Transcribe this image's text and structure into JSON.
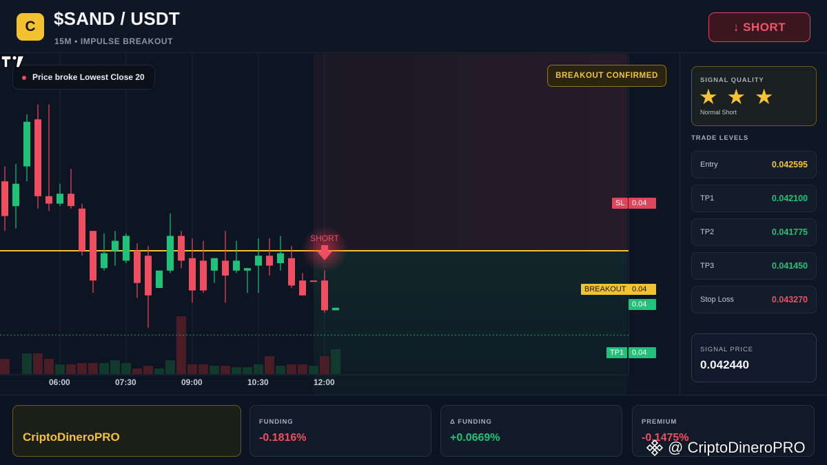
{
  "header": {
    "logo_letter": "C",
    "pair": "$SAND / USDT",
    "subtitle": "15M • IMPULSE BREAKOUT",
    "short_button": "↓ SHORT"
  },
  "chart": {
    "signal_pill": "Price broke Lowest Close 20",
    "confirmed_badge": "BREAKOUT CONFIRMED",
    "short_marker": "SHORT",
    "lines": {
      "sl": {
        "label": "SL",
        "value": "0.04"
      },
      "breakout": {
        "label": "BREAKOUT",
        "value": "0.04"
      },
      "current": {
        "value": "0.04"
      },
      "tp1": {
        "label": "TP1",
        "value": "0.04"
      }
    },
    "x_labels": [
      "06:00",
      "07:30",
      "09:00",
      "10:30",
      "12:00"
    ],
    "colors": {
      "up": "#21c17a",
      "down": "#ef4d60",
      "breakout": "#f3c230",
      "sl": "#e0455c",
      "tp": "#21c17a"
    }
  },
  "chart_data": {
    "type": "candlestick",
    "x_tick_labels": [
      "06:00",
      "07:30",
      "09:00",
      "10:30",
      "12:00"
    ],
    "candles": [
      {
        "o": 0.04272,
        "h": 0.04278,
        "c": 0.04258,
        "l": 0.04252
      },
      {
        "o": 0.04262,
        "h": 0.04279,
        "c": 0.04271,
        "l": 0.04253
      },
      {
        "o": 0.04278,
        "h": 0.04299,
        "c": 0.04296,
        "l": 0.04272
      },
      {
        "o": 0.04297,
        "h": 0.04303,
        "c": 0.04266,
        "l": 0.04261
      },
      {
        "o": 0.04266,
        "h": 0.04303,
        "c": 0.04263,
        "l": 0.0426
      },
      {
        "o": 0.04263,
        "h": 0.04271,
        "c": 0.04267,
        "l": 0.04262
      },
      {
        "o": 0.04267,
        "h": 0.04277,
        "c": 0.04262,
        "l": 0.04261
      },
      {
        "o": 0.04261,
        "h": 0.04263,
        "c": 0.04244,
        "l": 0.04242
      },
      {
        "o": 0.04252,
        "h": 0.04251,
        "c": 0.04232,
        "l": 0.04227
      },
      {
        "o": 0.04237,
        "h": 0.04251,
        "c": 0.04243,
        "l": 0.04236
      },
      {
        "o": 0.04244,
        "h": 0.04252,
        "c": 0.04248,
        "l": 0.04238
      },
      {
        "o": 0.0424,
        "h": 0.04251,
        "c": 0.0425,
        "l": 0.04239
      },
      {
        "o": 0.04244,
        "h": 0.04247,
        "c": 0.04231,
        "l": 0.04225
      },
      {
        "o": 0.04242,
        "h": 0.04246,
        "c": 0.04226,
        "l": 0.04213
      },
      {
        "o": 0.04229,
        "h": 0.04236,
        "c": 0.04236,
        "l": 0.04229
      },
      {
        "o": 0.04236,
        "h": 0.04259,
        "c": 0.0425,
        "l": 0.04235
      },
      {
        "o": 0.0425,
        "h": 0.04252,
        "c": 0.0424,
        "l": 0.04237
      },
      {
        "o": 0.04241,
        "h": 0.04249,
        "c": 0.04228,
        "l": 0.04223
      },
      {
        "o": 0.0424,
        "h": 0.04248,
        "c": 0.04228,
        "l": 0.04227
      },
      {
        "o": 0.04236,
        "h": 0.04241,
        "c": 0.04241,
        "l": 0.04231
      },
      {
        "o": 0.0424,
        "h": 0.04252,
        "c": 0.04234,
        "l": 0.04223
      },
      {
        "o": 0.04236,
        "h": 0.04248,
        "c": 0.0424,
        "l": 0.04235
      },
      {
        "o": 0.04236,
        "h": 0.04237,
        "c": 0.04237,
        "l": 0.04227
      },
      {
        "o": 0.04238,
        "h": 0.04249,
        "c": 0.04242,
        "l": 0.04227
      },
      {
        "o": 0.04242,
        "h": 0.04249,
        "c": 0.04238,
        "l": 0.04234
      },
      {
        "o": 0.04239,
        "h": 0.0425,
        "c": 0.04243,
        "l": 0.04236
      },
      {
        "o": 0.04241,
        "h": 0.04246,
        "c": 0.0423,
        "l": 0.04229
      },
      {
        "o": 0.04232,
        "h": 0.04235,
        "c": 0.04226,
        "l": 0.04226
      },
      {
        "o": 0.04232,
        "h": 0.04232,
        "c": 0.04232,
        "l": 0.04232
      },
      {
        "o": 0.04232,
        "h": 0.04236,
        "c": 0.0422,
        "l": 0.04219
      },
      {
        "o": 0.0422,
        "h": 0.04221,
        "c": 0.04221,
        "l": 0.0422
      }
    ],
    "volume": [
      22,
      0,
      30,
      30,
      22,
      14,
      14,
      16,
      16,
      16,
      20,
      16,
      8,
      12,
      8,
      20,
      84,
      14,
      14,
      12,
      12,
      10,
      10,
      14,
      26,
      12,
      14,
      14,
      12,
      26,
      36
    ],
    "levels": {
      "stop_loss": 0.04327,
      "breakout": 0.04244,
      "tp1": 0.0421
    },
    "y_labels_displayed": "0.04"
  },
  "sidebar": {
    "quality_title": "SIGNAL QUALITY",
    "stars": "★ ★ ★",
    "star_count": 3,
    "quality_note": "Normal Short",
    "levels_title": "TRADE LEVELS",
    "levels": [
      {
        "name": "Entry",
        "value": "0.042595",
        "color": "#f3c230"
      },
      {
        "name": "TP1",
        "value": "0.042100",
        "color": "#21c17a"
      },
      {
        "name": "TP2",
        "value": "0.041775",
        "color": "#21c17a"
      },
      {
        "name": "TP3",
        "value": "0.041450",
        "color": "#21c17a"
      },
      {
        "name": "Stop Loss",
        "value": "0.043270",
        "color": "#ef4d60"
      }
    ],
    "signal_price_title": "SIGNAL PRICE",
    "signal_price": "0.042440"
  },
  "footer": {
    "brand": "CriptoDineroPRO",
    "cards": [
      {
        "title": "FUNDING",
        "value": "-0.1816%",
        "color": "#ef4d60"
      },
      {
        "title": "Δ FUNDING",
        "value": "+0.0669%",
        "color": "#21c17a"
      },
      {
        "title": "PREMIUM",
        "value": "-0.1475%",
        "color": "#ef4d60"
      }
    ],
    "watermark": "@ CriptoDineroPRO"
  }
}
